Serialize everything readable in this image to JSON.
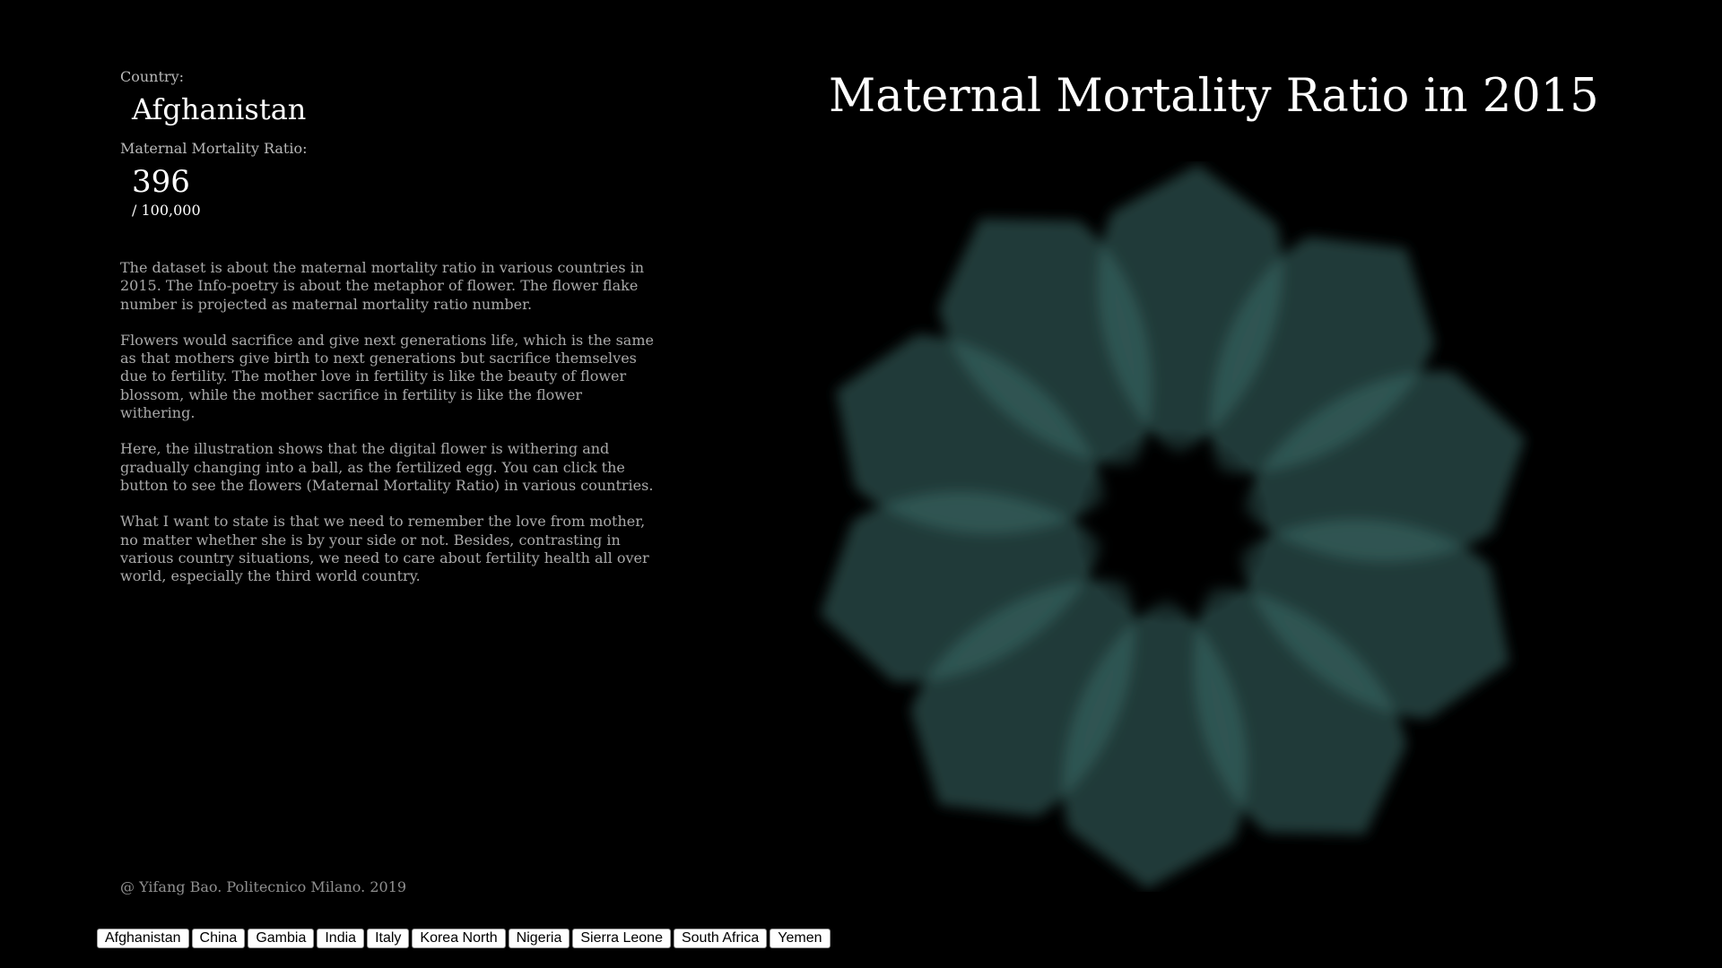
{
  "title": "Maternal Mortality Ratio in 2015",
  "info": {
    "country_label": "Country:",
    "country_value": "Afghanistan",
    "mmr_label": "Maternal Mortality Ratio:",
    "mmr_value": "396",
    "mmr_unit": "/ 100,000"
  },
  "description": [
    "The dataset is about the maternal mortality ratio in various countries in 2015. The Info-poetry is about the metaphor of flower. The flower flake number is projected as maternal mortality ratio number.",
    "Flowers would sacrifice and give next generations life, which is the same as that mothers give birth to next generations but sacrifice themselves due to fertility. The mother love in fertility is like the beauty of flower blossom, while the mother sacrifice in fertility is like the flower withering.",
    "Here, the illustration shows that the digital flower is withering and gradually changing into a ball, as the fertilized egg. You can click the button to see the flowers (Maternal Mortality Ratio) in various countries.",
    "What I want to state is that we need to remember the love from mother, no matter whether she is by your side or not. Besides, contrasting in various country situations, we need to care about fertility health all over world, especially the third world country."
  ],
  "credit": "@ Yifang Bao. Politecnico Milano. 2019",
  "countries": [
    "Afghanistan",
    "China",
    "Gambia",
    "India",
    "Italy",
    "Korea North",
    "Nigeria",
    "Sierra Leone",
    "South Africa",
    "Yemen"
  ],
  "flower": {
    "petal_count": 10,
    "colors": {
      "center": "#000000",
      "inner": "#d42a2a",
      "mid": "#7a4545",
      "outer": "#3a6a66"
    }
  }
}
